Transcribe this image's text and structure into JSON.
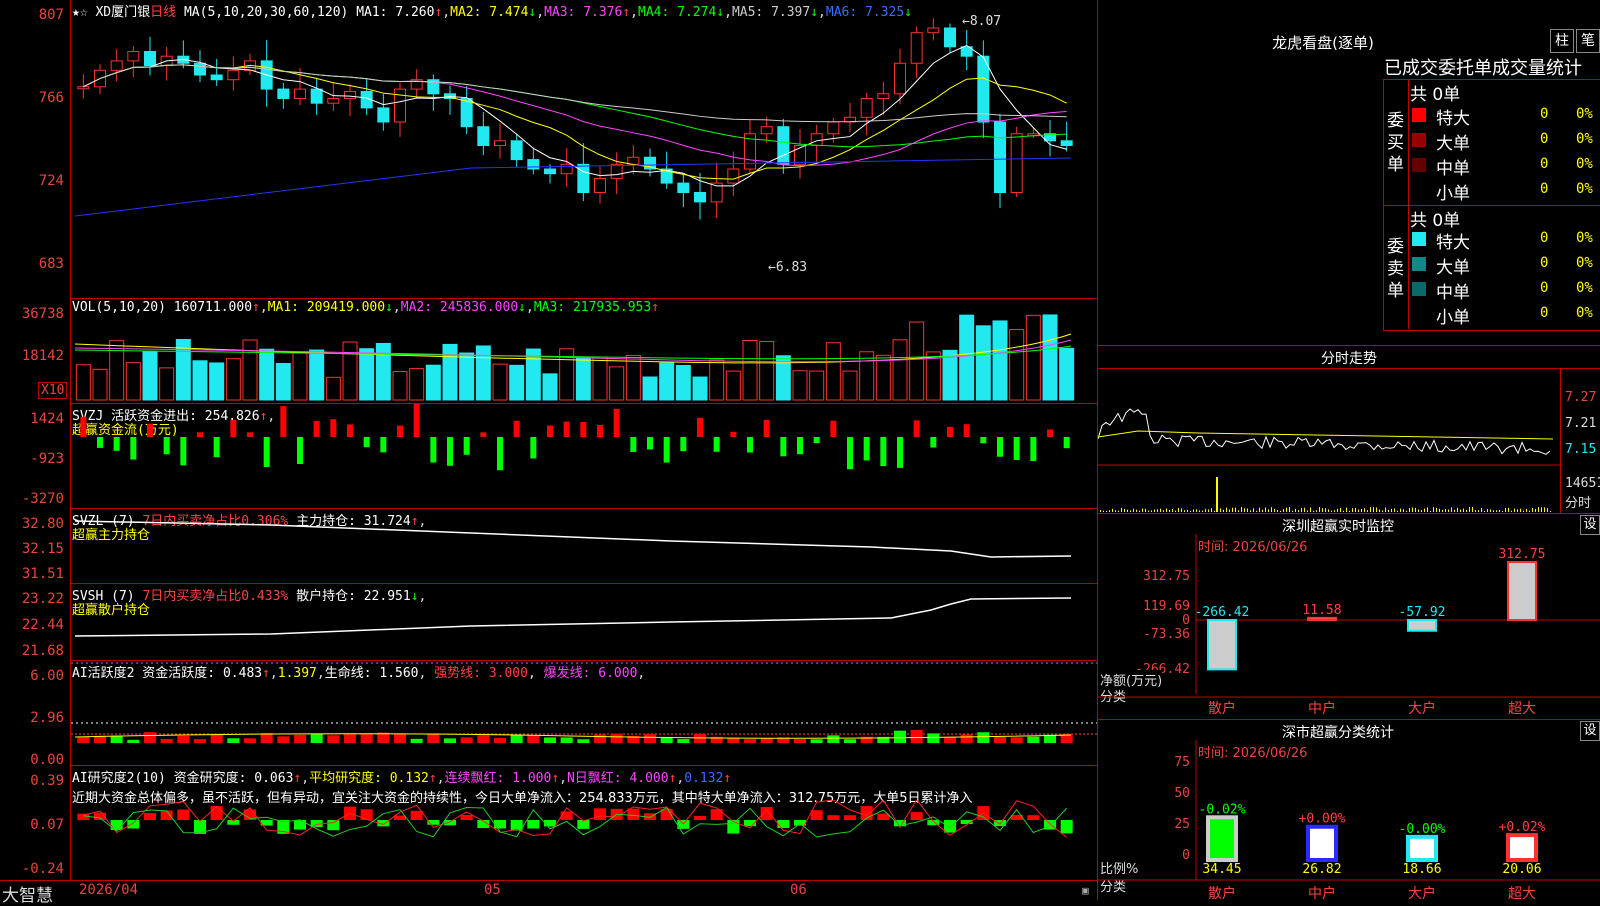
{
  "colors": {
    "up": "#ff3030",
    "down": "#22e8f0",
    "grid": "#c00000",
    "ma1": "#ffffff",
    "ma2": "#ffff00",
    "ma3": "#ff44ff",
    "ma4": "#00ff00",
    "ma5": "#cccccc",
    "ma6": "#2233ff"
  },
  "title": {
    "star": "★☆",
    "name": "XD厦门银",
    "period": "日线",
    "ma_params": "MA(5,10,20,30,60,120)",
    "ma1": "MA1: 7.260",
    "ma2": "MA2: 7.474",
    "ma3": "MA3: 7.376",
    "ma4": "MA4: 7.274",
    "ma5": "MA5: 7.397",
    "ma6": "MA6: 7.325"
  },
  "price_axis": [
    "807",
    "766",
    "724",
    "683"
  ],
  "price_notes": {
    "high": "8.07",
    "low": "6.83"
  },
  "vol": {
    "params": "VOL(5,10,20)",
    "value": "160711.000",
    "ma1": "MA1: 209419.000",
    "ma2": "MA2: 245836.000",
    "ma3": "MA3: 217935.953",
    "axis": [
      "36738",
      "18142"
    ],
    "unit": "X10"
  },
  "svzj": {
    "label": "SVZJ  活跃资金进出: 254.826",
    "sub": "超赢资金流(万元)",
    "axis": [
      "1424",
      "-923",
      "-3270"
    ]
  },
  "svzl": {
    "label": "SVZL (7)",
    "pct": "7日内买卖净占比0.306%",
    "main": "主力持仓: 31.724",
    "sub": "超赢主力持仓",
    "axis": [
      "32.80",
      "32.15",
      "31.51"
    ]
  },
  "svsh": {
    "label": "SVSH (7)",
    "pct": "7日内买卖净占比0.433%",
    "main": "散户持仓: 22.951",
    "sub": "超赢散户持仓",
    "axis": [
      "23.22",
      "22.44",
      "21.68"
    ]
  },
  "ai1": {
    "label": "AI活跃度2 资金活跃度: 0.483",
    "v2": "1.397",
    "v3": "生命线: 1.560",
    "v4": "强势线: 3.000",
    "v5": "爆发线: 6.000",
    "axis": [
      "6.00",
      "2.96",
      "0.00"
    ]
  },
  "ai2": {
    "label": "AI研究度2(10) 资金研究度: 0.063",
    "v2": "平均研究度: 0.132",
    "v3": "连续飘红: 1.000",
    "v4": "N日飘红: 4.000",
    "v5": "0.132",
    "comment": "近期大资金总体偏多，虽不活跃，但有异动，宜关注大资金的持续性，今日大单净流入：254.833万元，其中特大单净流入：312.75万元，大单5日累计净入",
    "axis": [
      "0.39",
      "0.07",
      "-0.24"
    ]
  },
  "xaxis": {
    "labels": [
      "2026/04",
      "05",
      "06"
    ]
  },
  "brand": "大智慧",
  "lhkp": {
    "title": "龙虎看盘(逐单)",
    "btn1": "柱",
    "btn2": "笔",
    "sub": "已成交委托单成交量统计",
    "buy_label": "委买单",
    "sell_label": "委卖单",
    "buy_total": "共 0单",
    "sell_total": "共 0单",
    "buy_rows": [
      {
        "name": "特大",
        "v": "0",
        "p": "0%",
        "c": "#ff0000"
      },
      {
        "name": "大单",
        "v": "0",
        "p": "0%",
        "c": "#990000"
      },
      {
        "name": "中单",
        "v": "0",
        "p": "0%",
        "c": "#660000"
      },
      {
        "name": "小单",
        "v": "0",
        "p": "0%",
        "c": ""
      }
    ],
    "sell_rows": [
      {
        "name": "特大",
        "v": "0",
        "p": "0%",
        "c": "#22e8f0"
      },
      {
        "name": "大单",
        "v": "0",
        "p": "0%",
        "c": "#108888"
      },
      {
        "name": "中单",
        "v": "0",
        "p": "0%",
        "c": "#0a6a6a"
      },
      {
        "name": "小单",
        "v": "0",
        "p": "0%",
        "c": ""
      }
    ]
  },
  "intraday": {
    "title": "分时走势",
    "p1": "7.27",
    "p2": "7.21",
    "p3": "7.15",
    "vol": "14651",
    "vol_unit": "分时"
  },
  "szsv": {
    "title": "深圳超赢实时监控",
    "btn": "设",
    "date": "时间: 2026/06/26",
    "axis": [
      "312.75",
      "119.69",
      "0",
      "-73.36",
      "-266.42"
    ],
    "y_title": "净额(万元)",
    "x_title": "分类",
    "cats": [
      "散户",
      "中户",
      "大户",
      "超大"
    ],
    "values": [
      "-266.42",
      "11.58",
      "-57.92",
      "312.75"
    ]
  },
  "szcls": {
    "title": "深市超赢分类统计",
    "btn": "设",
    "date": "时间: 2026/06/26",
    "axis": [
      "75",
      "50",
      "25",
      "0"
    ],
    "y_title": "比例%",
    "x_title": "分类",
    "cats": [
      "散户",
      "中户",
      "大户",
      "超大"
    ],
    "values": [
      "34.45",
      "26.82",
      "18.66",
      "20.06"
    ],
    "changes": [
      "-0.02%",
      "+0.00%",
      "-0.00%",
      "+0.02%"
    ]
  }
}
